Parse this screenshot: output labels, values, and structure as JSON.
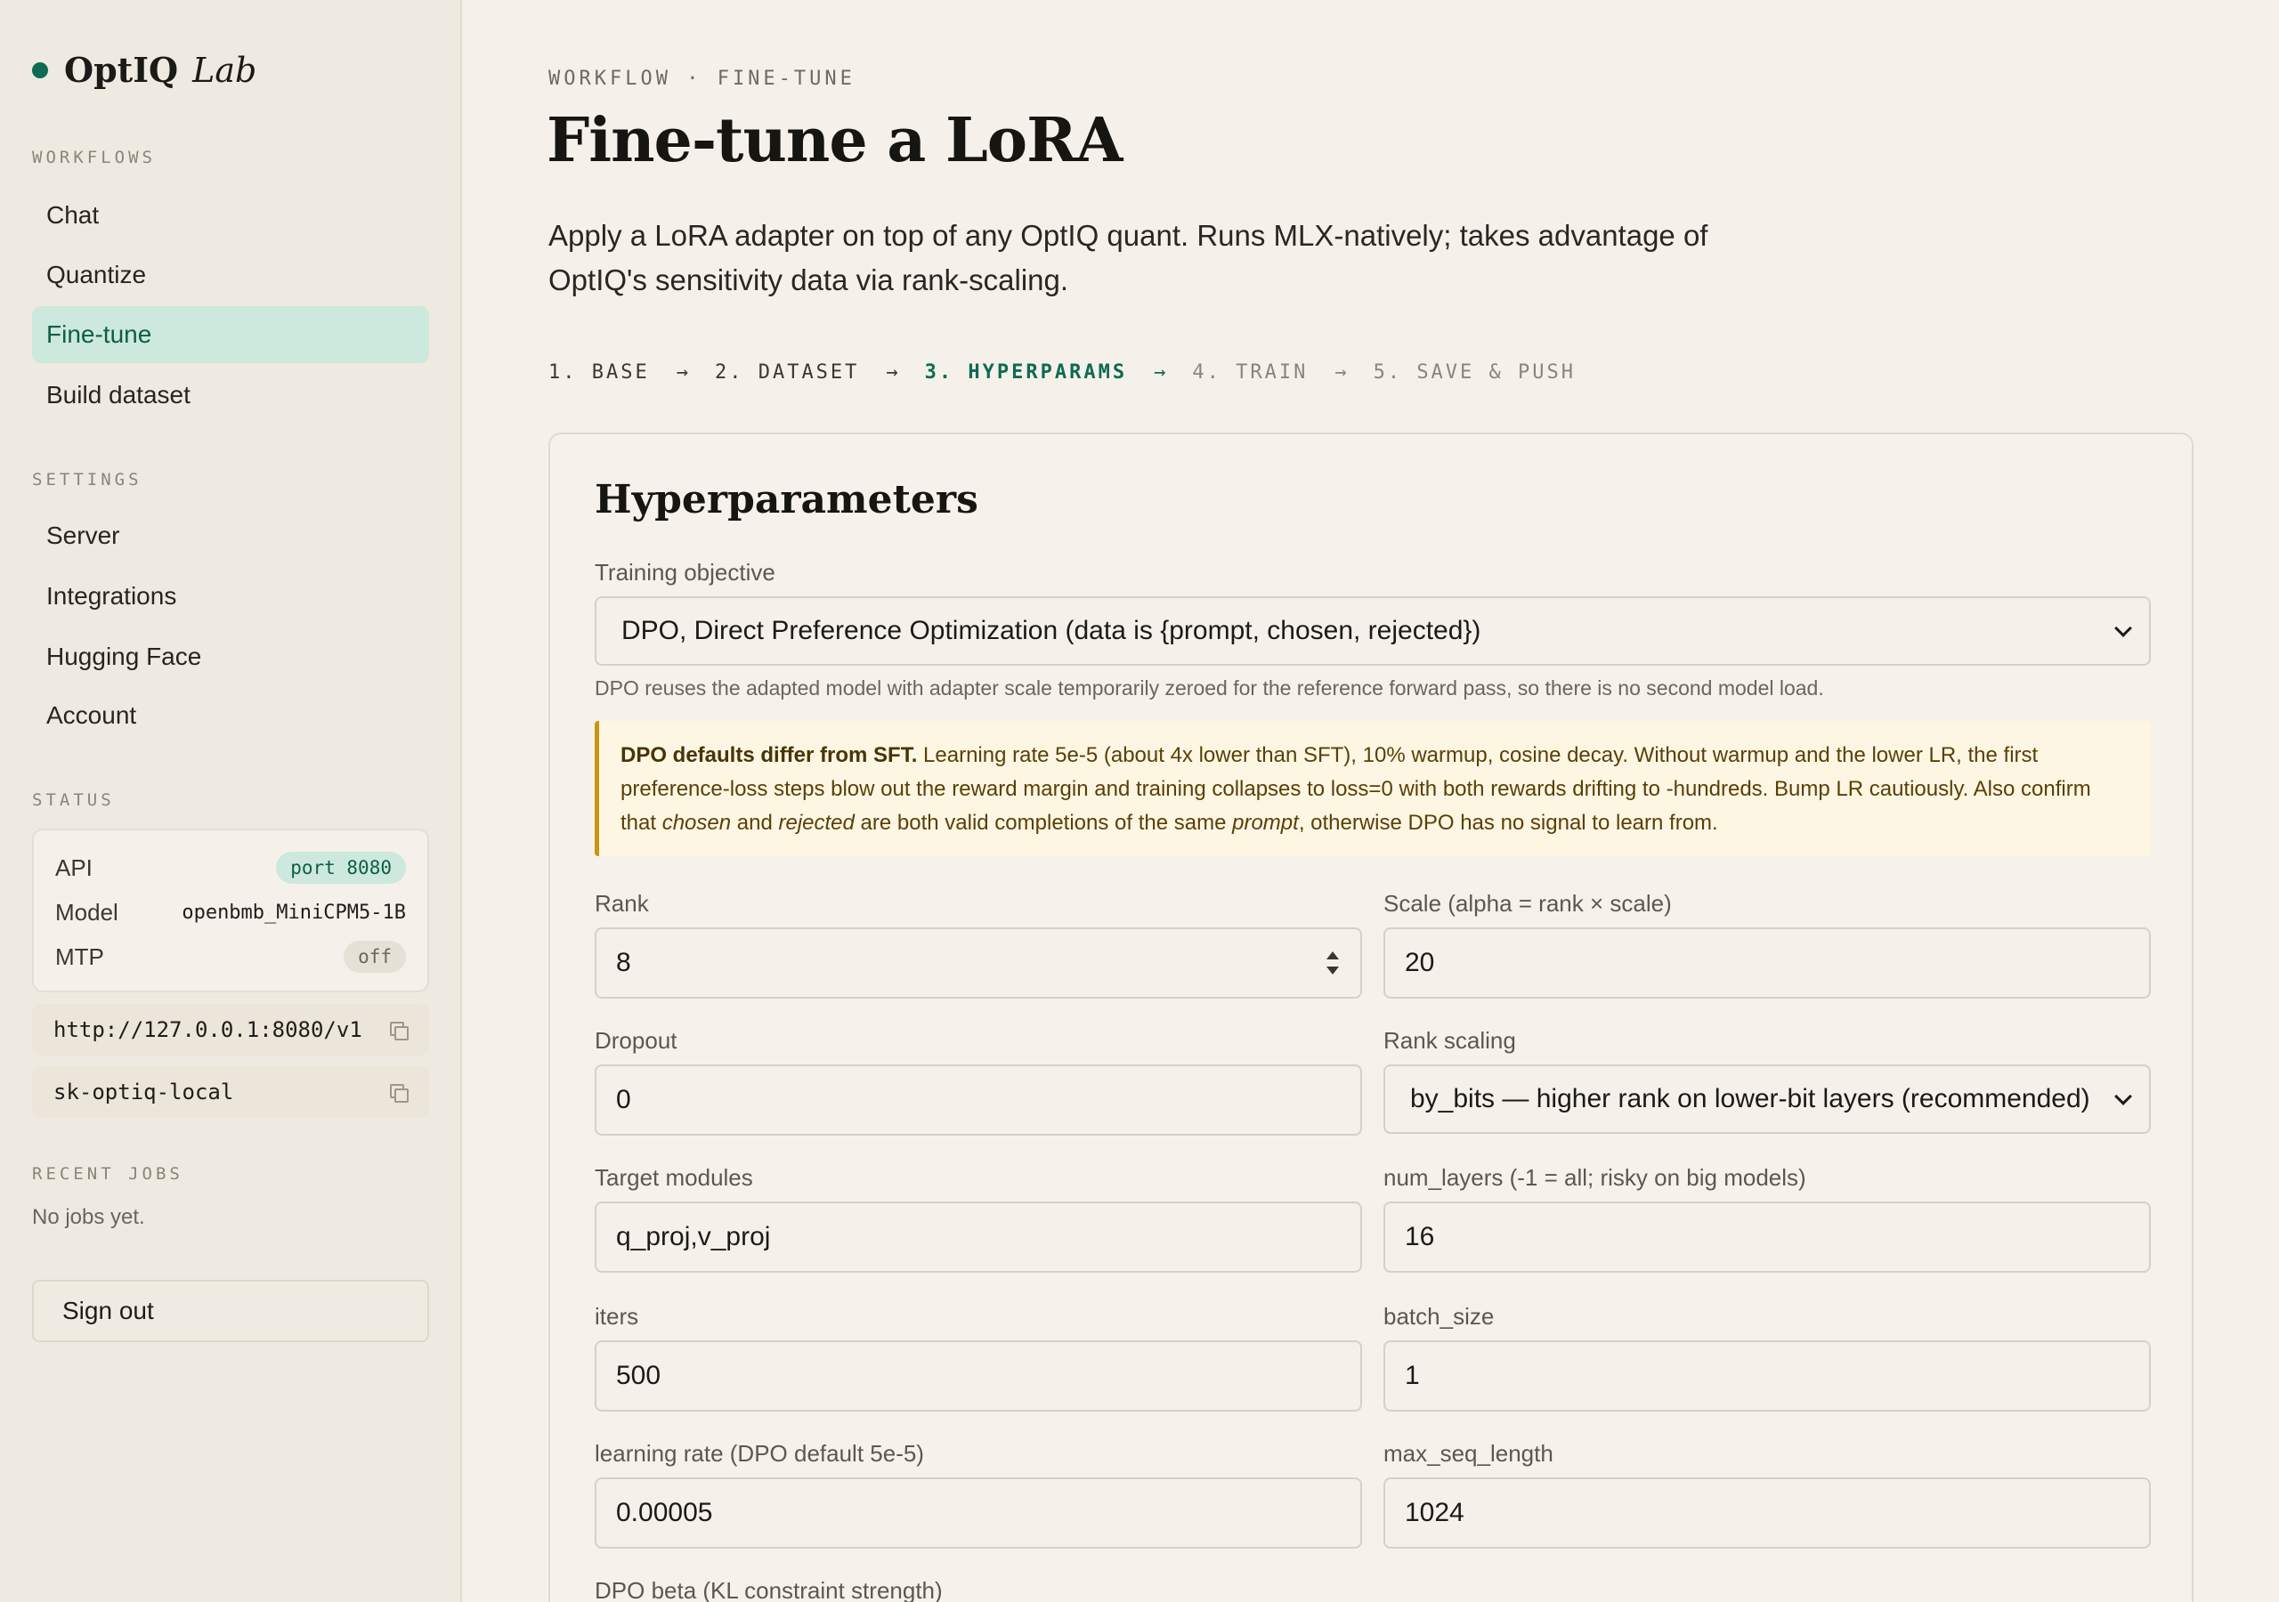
{
  "brand": {
    "name": "OptIQ",
    "suffix": "Lab",
    "accent": "#0d6b52"
  },
  "sidebar": {
    "workflows_label": "WORKFLOWS",
    "workflows": [
      {
        "label": "Chat"
      },
      {
        "label": "Quantize"
      },
      {
        "label": "Fine-tune",
        "active": true
      },
      {
        "label": "Build dataset"
      }
    ],
    "settings_label": "SETTINGS",
    "settings": [
      {
        "label": "Server"
      },
      {
        "label": "Integrations"
      },
      {
        "label": "Hugging Face"
      },
      {
        "label": "Account"
      }
    ],
    "status_label": "STATUS",
    "status": {
      "api_key": "API",
      "api_value": "port 8080",
      "model_key": "Model",
      "model_value": "openbmb_MiniCPM5-1B",
      "mtp_key": "MTP",
      "mtp_value": "off"
    },
    "endpoint_url": "http://127.0.0.1:8080/v1",
    "api_token": "sk-optiq-local",
    "recent_jobs_label": "RECENT JOBS",
    "recent_jobs_empty": "No jobs yet.",
    "sign_out": "Sign out"
  },
  "main": {
    "eyebrow": "WORKFLOW · FINE-TUNE",
    "title": "Fine-tune a LoRA",
    "lede": "Apply a LoRA adapter on top of any OptIQ quant. Runs MLX-natively; takes advantage of OptIQ's sensitivity data via rank-scaling.",
    "steps": [
      {
        "label": "1. BASE",
        "state": "done"
      },
      {
        "label": "2. DATASET",
        "state": "done"
      },
      {
        "label": "3. HYPERPARAMS",
        "state": "active"
      },
      {
        "label": "4. TRAIN",
        "state": "future"
      },
      {
        "label": "5. SAVE & PUSH",
        "state": "future"
      }
    ],
    "step_arrow": "→"
  },
  "form": {
    "title": "Hyperparameters",
    "objective_label": "Training objective",
    "objective_value": "DPO, Direct Preference Optimization (data is {prompt, chosen, rejected})",
    "objective_hint": "DPO reuses the adapted model with adapter scale temporarily zeroed for the reference forward pass, so there is no second model load.",
    "callout": {
      "title": "DPO defaults differ from SFT.",
      "body1": " Learning rate 5e-5 (about 4x lower than SFT), 10% warmup, cosine decay. Without warmup and the lower LR, the first preference-loss steps blow out the reward margin and training collapses to loss=0 with both rewards drifting to -hundreds. Bump LR cautiously. Also confirm that ",
      "chosen": "chosen",
      "and": " and ",
      "rejected": "rejected",
      "body2": " are both valid completions of the same ",
      "prompt": "prompt",
      "body3": ", otherwise DPO has no signal to learn from."
    },
    "rank_label": "Rank",
    "rank_value": "8",
    "scale_label": "Scale (alpha = rank × scale)",
    "scale_value": "20",
    "dropout_label": "Dropout",
    "dropout_value": "0",
    "rank_scaling_label": "Rank scaling",
    "rank_scaling_value": "by_bits — higher rank on lower-bit layers (recommended)",
    "target_modules_label": "Target modules",
    "target_modules_value": "q_proj,v_proj",
    "num_layers_label": "num_layers (-1 = all; risky on big models)",
    "num_layers_value": "16",
    "iters_label": "iters",
    "iters_value": "500",
    "batch_size_label": "batch_size",
    "batch_size_value": "1",
    "lr_label": "learning rate (DPO default 5e-5)",
    "lr_value": "0.00005",
    "max_seq_label": "max_seq_length",
    "max_seq_value": "1024",
    "beta_label": "DPO beta (KL constraint strength)"
  }
}
